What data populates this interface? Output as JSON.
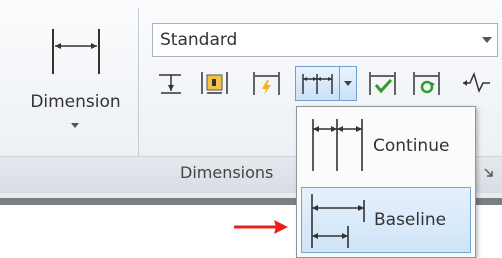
{
  "ribbon": {
    "dimension_button": {
      "label": "Dimension"
    },
    "style_combo": {
      "value": "Standard"
    },
    "panel_title": "Dimensions",
    "tools": [
      {
        "name": "dimension-tool-1-icon"
      },
      {
        "name": "dimension-tool-2-icon"
      },
      {
        "name": "dimension-tool-3-icon"
      },
      {
        "name": "continue-split-icon"
      },
      {
        "name": "dimension-tool-5-icon"
      },
      {
        "name": "dimension-tool-6-icon"
      },
      {
        "name": "dimension-tool-7-icon"
      }
    ]
  },
  "dropdown": {
    "items": [
      {
        "label": "Continue",
        "icon": "continue-dimension-icon",
        "selected": false
      },
      {
        "label": "Baseline",
        "icon": "baseline-dimension-icon",
        "selected": true
      }
    ]
  },
  "colors": {
    "accent_blue": "#6fa6dc",
    "annotation_red": "#e8201c",
    "ribbon_bottom": "#7a7d82"
  }
}
